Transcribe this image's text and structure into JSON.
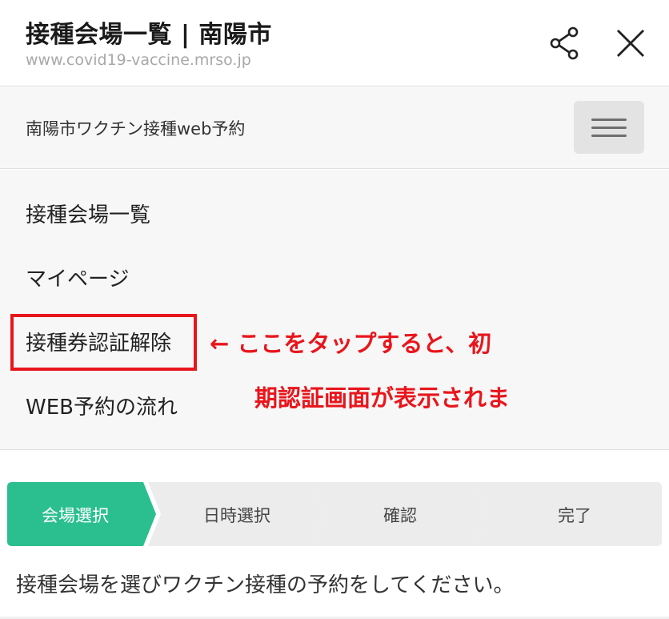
{
  "browser": {
    "title": "接種会場一覧 | 南陽市",
    "url": "www.covid19-vaccine.mrso.jp",
    "share_icon": "share-icon",
    "close_icon": "close-icon"
  },
  "site": {
    "name": "南陽市ワクチン接種web予約",
    "menu_icon": "hamburger-menu-icon"
  },
  "menu": {
    "items": [
      {
        "label": "接種会場一覧"
      },
      {
        "label": "マイページ"
      },
      {
        "label": "接種券認証解除"
      },
      {
        "label": "WEB予約の流れ"
      }
    ]
  },
  "annotation": {
    "line1": "← ここをタップすると、初",
    "line2": "期認証画面が表示されま",
    "color": "#e8161c"
  },
  "steps": {
    "items": [
      {
        "label": "会場選択",
        "active": true
      },
      {
        "label": "日時選択",
        "active": false
      },
      {
        "label": "確認",
        "active": false
      },
      {
        "label": "完了",
        "active": false
      }
    ],
    "active_color": "#2bbf8f",
    "inactive_color": "#ececec"
  },
  "instruction": "接種会場を選びワクチン接種の予約をしてください。"
}
